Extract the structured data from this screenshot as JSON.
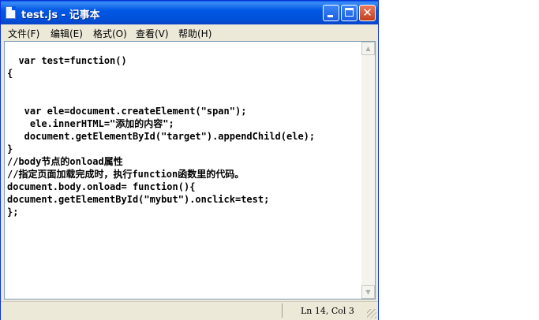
{
  "window": {
    "title": "test.js - 记事本"
  },
  "menu": [
    {
      "label": "文件(F)"
    },
    {
      "label": "编辑(E)"
    },
    {
      "label": "格式(O)"
    },
    {
      "label": "查看(V)"
    },
    {
      "label": "帮助(H)"
    }
  ],
  "editor": {
    "lines": [
      "  var test=function()",
      "{",
      "",
      "",
      "   var ele=document.createElement(\"span\");",
      "    ele.innerHTML=\"添加的内容\";",
      "   document.getElementById(\"target\").appendChild(ele);",
      "}",
      "//body节点的onload属性",
      "//指定页面加载完成时，执行function函数里的代码。",
      "document.body.onload= function(){",
      "document.getElementById(\"mybut\").onclick=test;",
      "};"
    ]
  },
  "status": {
    "position": "Ln 14, Col 3"
  },
  "icons": {
    "app": "notepad-icon",
    "minimize": "minimize-icon",
    "maximize": "maximize-icon",
    "close": "close-icon",
    "grip": "resize-grip-icon"
  }
}
